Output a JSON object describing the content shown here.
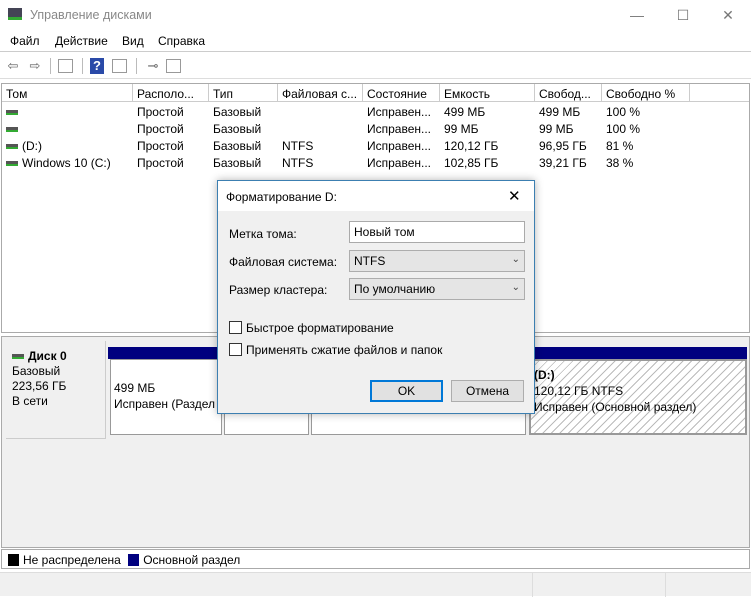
{
  "window": {
    "title": "Управление дисками",
    "minimize": "—",
    "maximize": "☐",
    "close": "✕"
  },
  "menu": [
    "Файл",
    "Действие",
    "Вид",
    "Справка"
  ],
  "toolbar": {
    "icons": [
      "back-icon",
      "forward-icon",
      "show-hide-tree-icon",
      "help-icon",
      "show-action-pane-icon",
      "connect-icon",
      "properties-icon"
    ]
  },
  "list": {
    "columns": [
      "Том",
      "Располо...",
      "Тип",
      "Файловая с...",
      "Состояние",
      "Емкость",
      "Свобод...",
      "Свободно %"
    ],
    "rows": [
      [
        "",
        "Простой",
        "Базовый",
        "",
        "Исправен...",
        "499 МБ",
        "499 МБ",
        "100 %"
      ],
      [
        "",
        "Простой",
        "Базовый",
        "",
        "Исправен...",
        "99 МБ",
        "99 МБ",
        "100 %"
      ],
      [
        "(D:)",
        "Простой",
        "Базовый",
        "NTFS",
        "Исправен...",
        "120,12 ГБ",
        "96,95 ГБ",
        "81 %"
      ],
      [
        "Windows 10 (C:)",
        "Простой",
        "Базовый",
        "NTFS",
        "Исправен...",
        "102,85 ГБ",
        "39,21 ГБ",
        "38 %"
      ]
    ]
  },
  "disk": {
    "name": "Диск 0",
    "type": "Базовый",
    "size": "223,56 ГБ",
    "status": "В сети",
    "partitions": [
      {
        "size": "499 МБ",
        "status": "Исправен (Раздел"
      },
      {
        "size": "",
        "status": ""
      },
      {
        "size": "",
        "status": ""
      },
      {
        "label": "(D:)",
        "size": "120,12 ГБ NTFS",
        "status": "Исправен (Основной раздел)"
      }
    ]
  },
  "legend": [
    {
      "label": "Не распределена",
      "color": "#000000"
    },
    {
      "label": "Основной раздел",
      "color": "#00007f"
    }
  ],
  "dialog": {
    "title": "Форматирование D:",
    "close": "✕",
    "label_label": "Метка тома:",
    "label_value": "Новый том",
    "fs_label": "Файловая система:",
    "fs_value": "NTFS",
    "cluster_label": "Размер кластера:",
    "cluster_value": "По умолчанию",
    "quick_format": "Быстрое форматирование",
    "quick_format_checked": false,
    "compress": "Применять сжатие файлов и папок",
    "compress_checked": false,
    "ok": "OK",
    "cancel": "Отмена"
  }
}
